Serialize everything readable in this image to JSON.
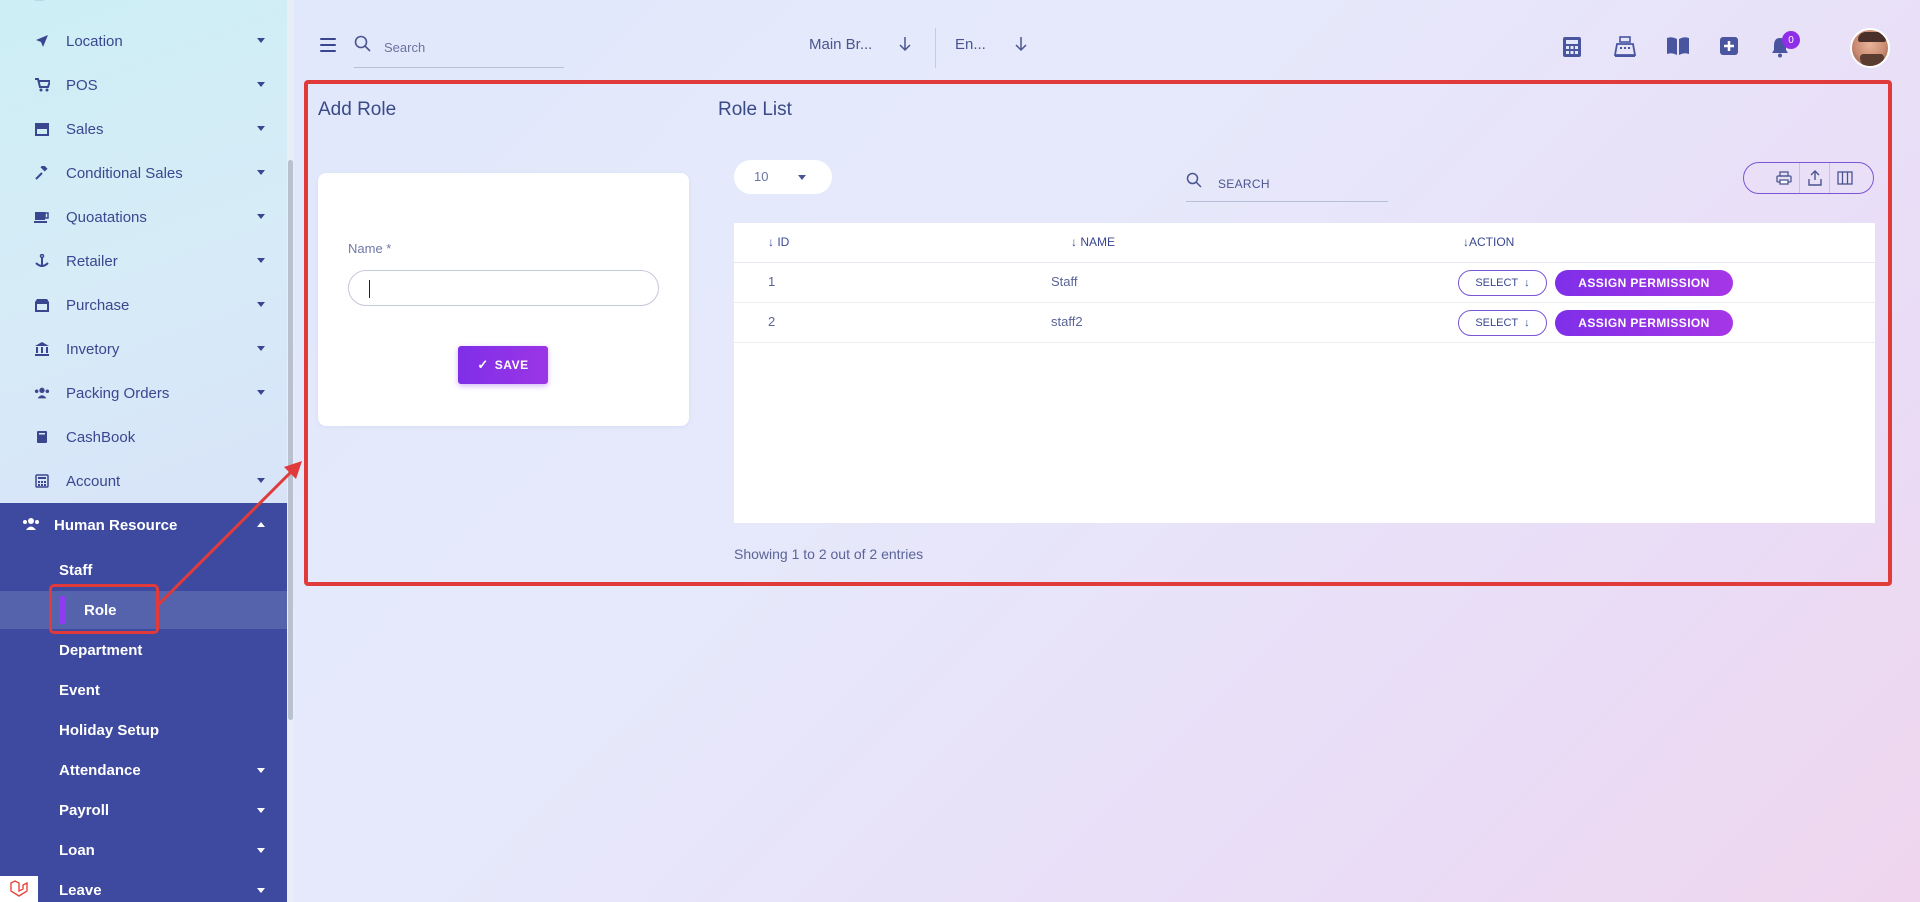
{
  "sidebar": {
    "items": [
      {
        "label": "Location",
        "icon": "location-arrow-icon"
      },
      {
        "label": "POS",
        "icon": "cart-icon"
      },
      {
        "label": "Sales",
        "icon": "store-icon"
      },
      {
        "label": "Conditional Sales",
        "icon": "gavel-icon"
      },
      {
        "label": "Quoatations",
        "icon": "mug-icon"
      },
      {
        "label": "Retailer",
        "icon": "anchor-icon"
      },
      {
        "label": "Purchase",
        "icon": "shop-icon"
      },
      {
        "label": "Invetory",
        "icon": "bank-icon"
      },
      {
        "label": "Packing Orders",
        "icon": "users-icon"
      },
      {
        "label": "CashBook",
        "icon": "book-icon"
      },
      {
        "label": "Account",
        "icon": "calculator-icon"
      }
    ],
    "hr": {
      "label": "Human Resource",
      "subitems": [
        {
          "label": "Staff"
        },
        {
          "label": "Role"
        },
        {
          "label": "Department"
        },
        {
          "label": "Event"
        },
        {
          "label": "Holiday Setup"
        },
        {
          "label": "Attendance"
        },
        {
          "label": "Payroll"
        },
        {
          "label": "Loan"
        },
        {
          "label": "Leave"
        }
      ]
    }
  },
  "topbar": {
    "search_placeholder": "Search",
    "branch": "Main Br...",
    "language": "En...",
    "notifications_count": "0"
  },
  "add_role": {
    "title": "Add Role",
    "name_label": "Name *",
    "name_value": "",
    "save_label": "SAVE"
  },
  "role_list": {
    "title": "Role List",
    "per_page": "10",
    "search_placeholder": "SEARCH",
    "columns": [
      "ID",
      "NAME",
      "ACTION"
    ],
    "rows": [
      {
        "id": "1",
        "name": "Staff"
      },
      {
        "id": "2",
        "name": "staff2"
      }
    ],
    "select_label": "SELECT",
    "assign_label": "ASSIGN PERMISSION",
    "showing": "Showing 1 to 2 out of 2 entries"
  },
  "colors": {
    "accent": "#8e2ee8",
    "sidebar_active": "#3e4aa0",
    "highlight": "#e03a3a"
  }
}
